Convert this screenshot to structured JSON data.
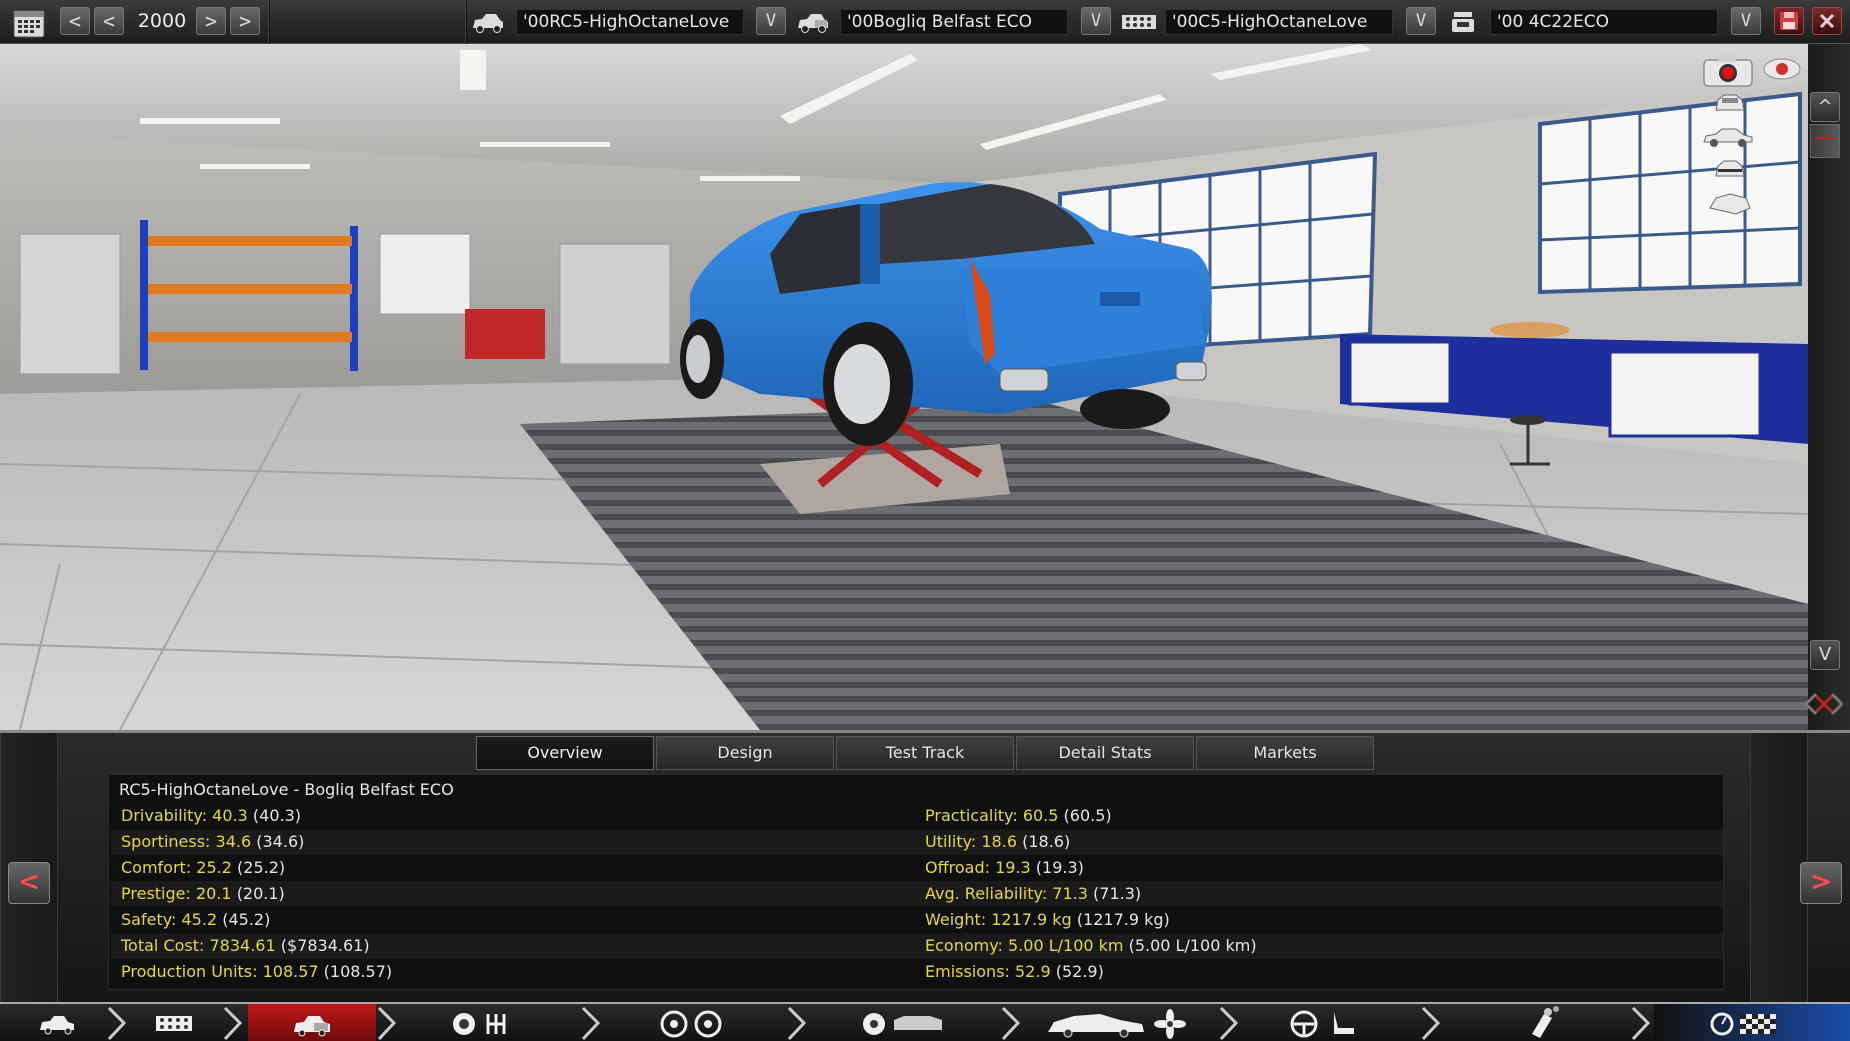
{
  "topbar": {
    "year": "2000",
    "prev_label": "<",
    "next_label": ">",
    "dropdown_label": "V",
    "slots": [
      {
        "text": "'00RC5-HighOctaneLove",
        "icon": "car-body-icon"
      },
      {
        "text": "'00Bogliq Belfast ECO",
        "icon": "car-variant-icon"
      },
      {
        "text": "'00C5-HighOctaneLove",
        "icon": "engine-family-icon"
      },
      {
        "text": "'00     4C22ECO",
        "icon": "engine-variant-icon"
      }
    ]
  },
  "viewport": {
    "scroll_up": "^",
    "scroll_down": "V"
  },
  "tabs": [
    {
      "label": "Overview",
      "active": true
    },
    {
      "label": "Design",
      "active": false
    },
    {
      "label": "Test Track",
      "active": false
    },
    {
      "label": "Detail Stats",
      "active": false
    },
    {
      "label": "Markets",
      "active": false
    }
  ],
  "overview": {
    "title": "RC5-HighOctaneLove - Bogliq Belfast ECO",
    "left": [
      {
        "label": "Drivability: 40.3",
        "ref": "(40.3)"
      },
      {
        "label": "Sportiness: 34.6",
        "ref": "(34.6)"
      },
      {
        "label": "Comfort: 25.2",
        "ref": "(25.2)"
      },
      {
        "label": "Prestige: 20.1",
        "ref": "(20.1)"
      },
      {
        "label": "Safety: 45.2",
        "ref": "(45.2)"
      },
      {
        "label": "Total Cost: 7834.61",
        "ref": "($7834.61)"
      },
      {
        "label": "Production Units: 108.57",
        "ref": "(108.57)"
      }
    ],
    "right": [
      {
        "label": "Practicality: 60.5",
        "ref": "(60.5)"
      },
      {
        "label": "Utility: 18.6",
        "ref": "(18.6)"
      },
      {
        "label": "Offroad: 19.3",
        "ref": "(19.3)"
      },
      {
        "label": "Avg. Reliability: 71.3",
        "ref": "(71.3)"
      },
      {
        "label": "Weight: 1217.9 kg",
        "ref": "(1217.9 kg)"
      },
      {
        "label": "Economy: 5.00 L/100 km",
        "ref": "(5.00 L/100 km)"
      },
      {
        "label": "Emissions: 52.9",
        "ref": "(52.9)"
      }
    ]
  },
  "panel_nav": {
    "prev": "<",
    "next": ">"
  },
  "colors": {
    "stat_label": "#e8d83a",
    "car_body": "#2a7fd8",
    "accent_red": "#c01818"
  },
  "bottom_nav_icons": [
    "car-body-icon",
    "engine-block-icon",
    "car-variant-icon",
    "engine-gearbox-icon",
    "suspension-wheels-icon",
    "brake-body-icon",
    "aero-fan-icon",
    "steering-seat-icon",
    "exhaust-icon",
    "test-finish-icon"
  ]
}
